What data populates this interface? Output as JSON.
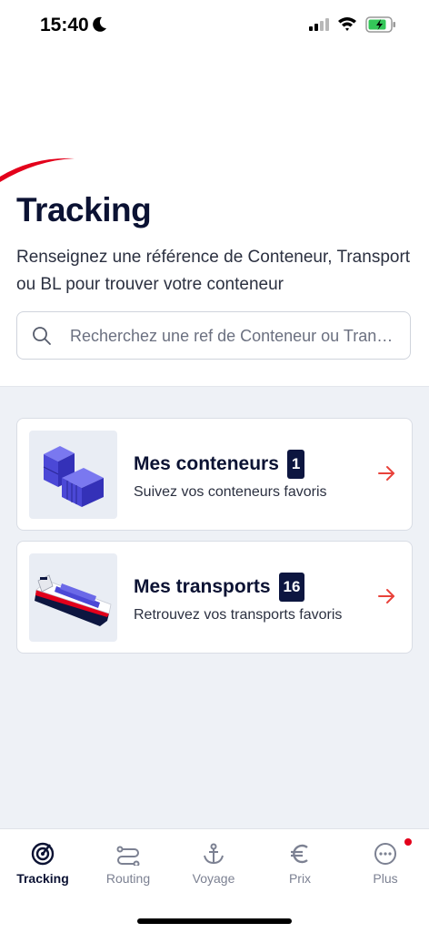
{
  "status_bar": {
    "time": "15:40"
  },
  "header": {
    "title": "Tracking",
    "subtitle": "Renseignez une référence de Conteneur, Transport ou BL pour trouver votre conteneur"
  },
  "search": {
    "placeholder": "Recherchez une ref de Conteneur ou Transport"
  },
  "cards": [
    {
      "title": "Mes conteneurs",
      "badge": "1",
      "description": "Suivez vos conteneurs favoris",
      "icon": "containers-icon"
    },
    {
      "title": "Mes transports",
      "badge": "16",
      "description": "Retrouvez vos transports favoris",
      "icon": "ship-icon"
    }
  ],
  "tabs": [
    {
      "label": "Tracking",
      "icon": "tracking-icon",
      "active": true
    },
    {
      "label": "Routing",
      "icon": "routing-icon"
    },
    {
      "label": "Voyage",
      "icon": "anchor-icon"
    },
    {
      "label": "Prix",
      "icon": "euro-icon"
    },
    {
      "label": "Plus",
      "icon": "more-icon"
    }
  ],
  "colors": {
    "accent_red": "#e3001b",
    "navy": "#0d1640",
    "arrow": "#e8423a"
  }
}
